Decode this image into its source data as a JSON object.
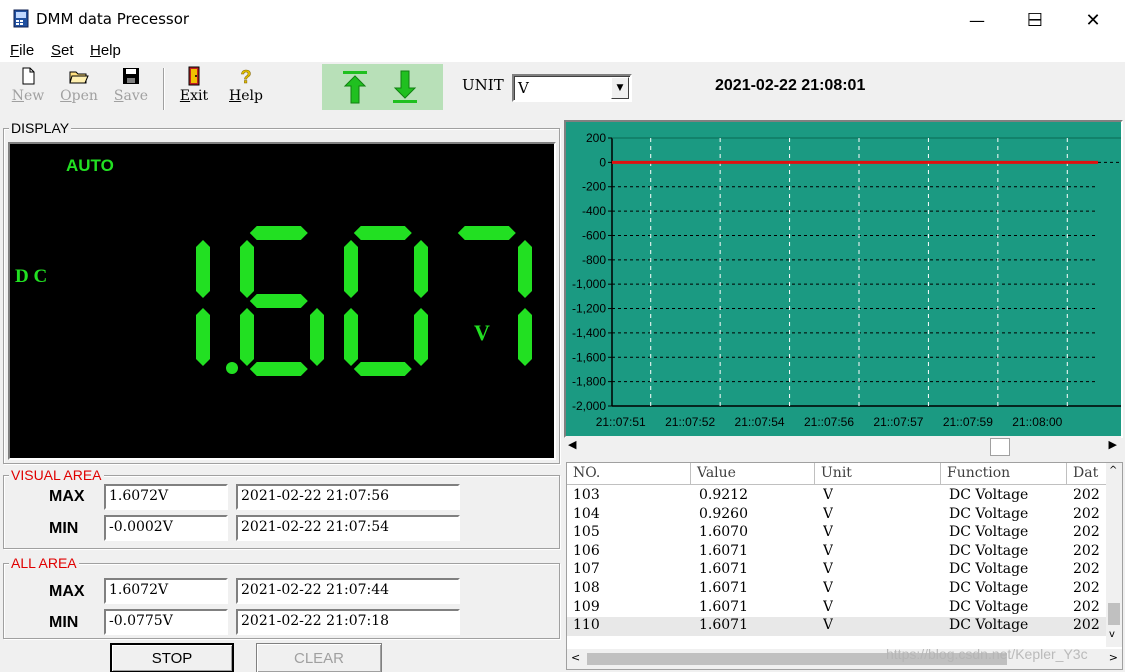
{
  "window": {
    "title": "DMM data Precessor",
    "minimize": "─",
    "maximize": "☐",
    "close": "✕"
  },
  "menu": [
    {
      "key": "F",
      "rest": "ile"
    },
    {
      "key": "S",
      "rest": "et"
    },
    {
      "key": "H",
      "rest": "elp"
    }
  ],
  "toolbar": {
    "new": "New",
    "open": "Open",
    "save": "Save",
    "exit": "Exit",
    "help": "Help",
    "new_key": "N",
    "new_rest": "ew",
    "open_key": "O",
    "open_rest": "pen",
    "save_key": "S",
    "save_rest": "ave",
    "exit_key": "E",
    "exit_rest": "xit",
    "help_key": "H",
    "help_rest": "elp"
  },
  "unit": {
    "label": "UNIT",
    "value": "V"
  },
  "datetime": "2021-02-22 21:08:01",
  "display": {
    "legend": "DISPLAY",
    "mode": "AUTO",
    "function": "D C",
    "reading": "1.6071",
    "unit": "V",
    "color": "#22e022"
  },
  "visual_area": {
    "legend": "VISUAL AREA",
    "max_label": "MAX",
    "max_value": "1.6072V",
    "max_time": "2021-02-22 21:07:56",
    "min_label": "MIN",
    "min_value": "-0.0002V",
    "min_time": "2021-02-22 21:07:54"
  },
  "all_area": {
    "legend": "ALL AREA",
    "max_label": "MAX",
    "max_value": "1.6072V",
    "max_time": "2021-02-22 21:07:44",
    "min_label": "MIN",
    "min_value": "-0.0775V",
    "min_time": "2021-02-22 21:07:18"
  },
  "buttons": {
    "stop": "STOP",
    "clear": "CLEAR"
  },
  "chart_data": {
    "type": "line",
    "yticks": [
      "200",
      "0",
      "-200",
      "-400",
      "-600",
      "-800",
      "-1,000",
      "-1,200",
      "-1,400",
      "-1,600",
      "-1,800",
      "-2,000"
    ],
    "ylim": [
      -2000,
      200
    ],
    "xticks": [
      "21::07:51",
      "21::07:52",
      "21::07:54",
      "21::07:56",
      "21::07:57",
      "21::07:59",
      "21::08:00"
    ],
    "series": [
      {
        "values": [
          0,
          0,
          0,
          0,
          0,
          0,
          0
        ],
        "color": "#e01010"
      }
    ],
    "background": "#1b9a82",
    "grid": true
  },
  "table": {
    "columns": [
      "NO.",
      "Value",
      "Unit",
      "Function",
      "Dat"
    ],
    "rows": [
      [
        "103",
        "0.9212",
        "V",
        "DC Voltage",
        "202"
      ],
      [
        "104",
        "0.9260",
        "V",
        "DC Voltage",
        "202"
      ],
      [
        "105",
        "1.6070",
        "V",
        "DC Voltage",
        "202"
      ],
      [
        "106",
        "1.6071",
        "V",
        "DC Voltage",
        "202"
      ],
      [
        "107",
        "1.6071",
        "V",
        "DC Voltage",
        "202"
      ],
      [
        "108",
        "1.6071",
        "V",
        "DC Voltage",
        "202"
      ],
      [
        "109",
        "1.6071",
        "V",
        "DC Voltage",
        "202"
      ],
      [
        "110",
        "1.6071",
        "V",
        "DC Voltage",
        "202"
      ]
    ]
  },
  "watermark": "https://blog.csdn.net/Kepler_Y3c"
}
